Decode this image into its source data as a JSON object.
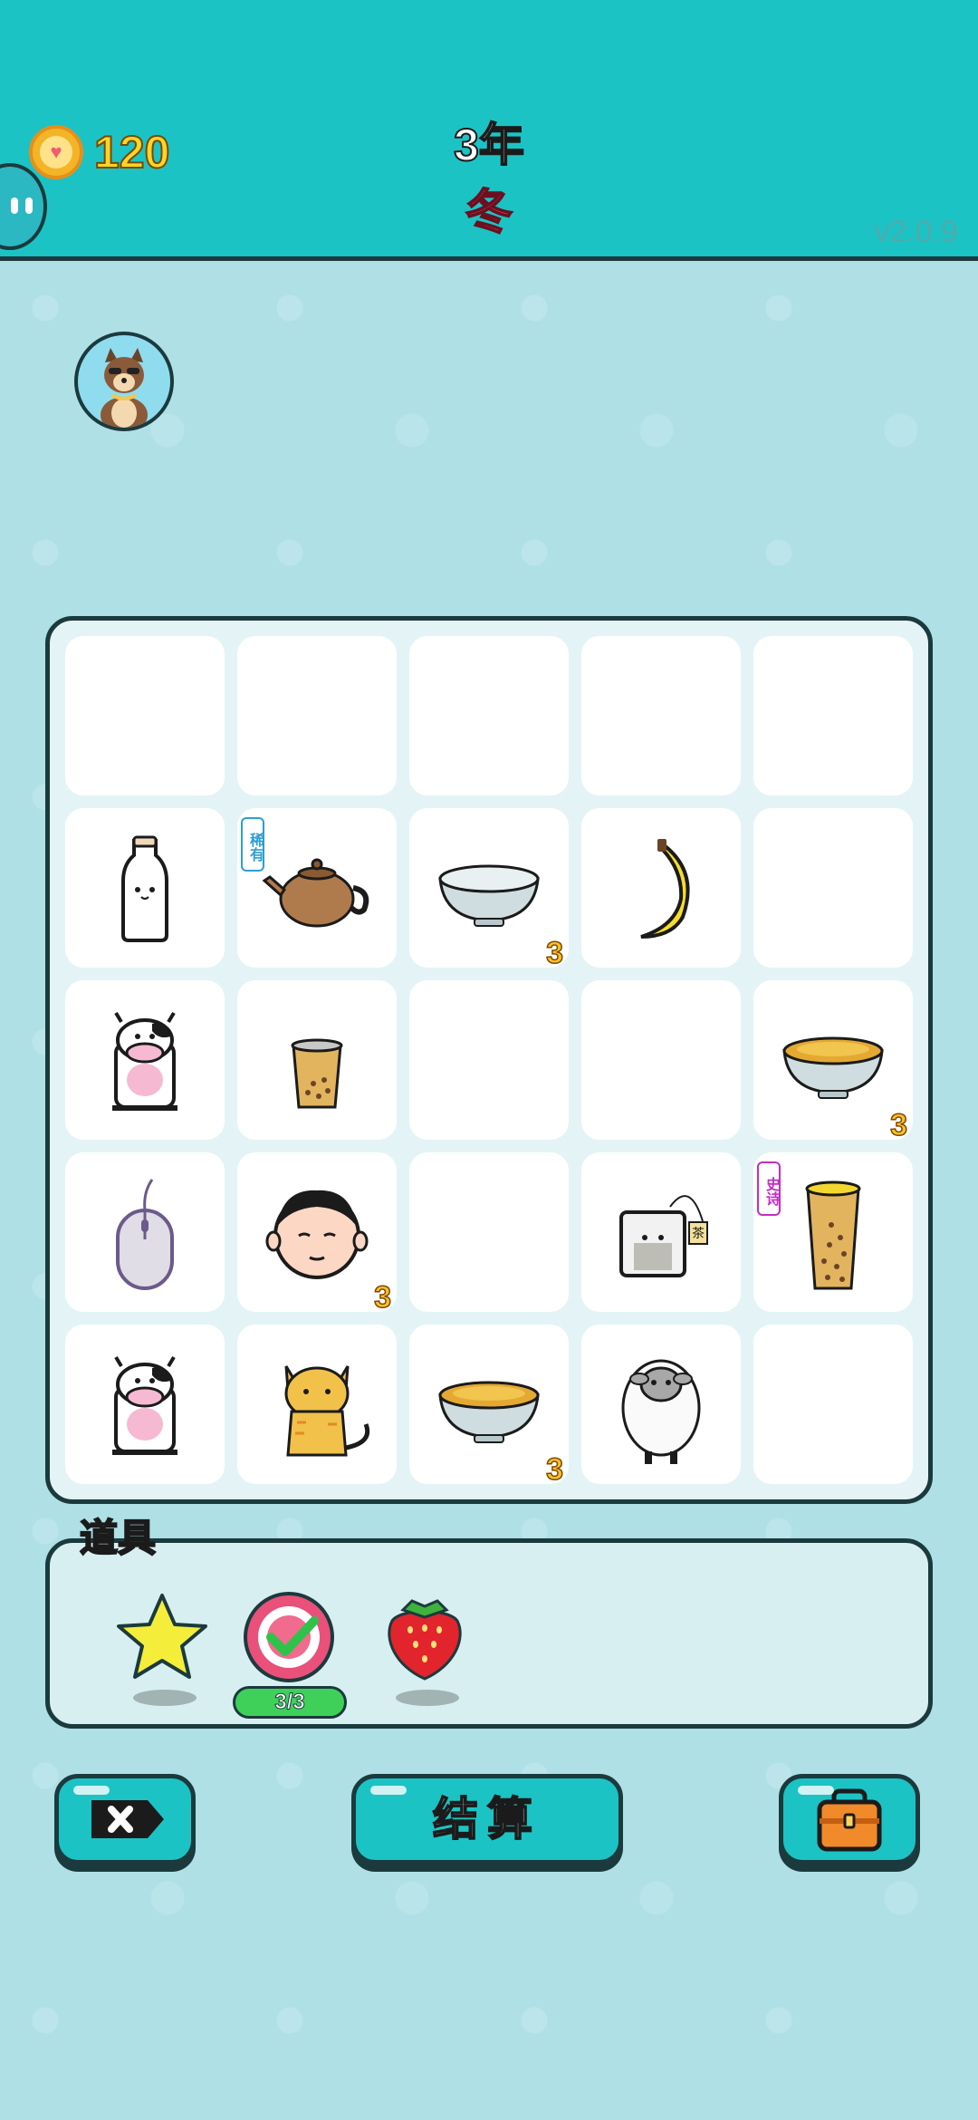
{
  "hud": {
    "coins": "120",
    "year": "3年",
    "season": "冬",
    "version": "v2.0.9"
  },
  "board": {
    "cells": [
      {
        "item": "",
        "count": "",
        "tag": ""
      },
      {
        "item": "",
        "count": "",
        "tag": ""
      },
      {
        "item": "",
        "count": "",
        "tag": ""
      },
      {
        "item": "",
        "count": "",
        "tag": ""
      },
      {
        "item": "",
        "count": "",
        "tag": ""
      },
      {
        "item": "milk-bottle",
        "count": "",
        "tag": ""
      },
      {
        "item": "teapot",
        "count": "",
        "tag": "稀有"
      },
      {
        "item": "empty-bowl",
        "count": "3",
        "tag": ""
      },
      {
        "item": "banana",
        "count": "",
        "tag": ""
      },
      {
        "item": "",
        "count": "",
        "tag": ""
      },
      {
        "item": "cow",
        "count": "",
        "tag": ""
      },
      {
        "item": "small-bubble-tea",
        "count": "",
        "tag": ""
      },
      {
        "item": "",
        "count": "",
        "tag": ""
      },
      {
        "item": "",
        "count": "",
        "tag": ""
      },
      {
        "item": "tea-bowl",
        "count": "3",
        "tag": ""
      },
      {
        "item": "mouse",
        "count": "",
        "tag": ""
      },
      {
        "item": "face",
        "count": "3",
        "tag": ""
      },
      {
        "item": "",
        "count": "",
        "tag": ""
      },
      {
        "item": "tea-bag",
        "count": "",
        "tag": ""
      },
      {
        "item": "tall-bubble-tea",
        "count": "",
        "tag": "史诗"
      },
      {
        "item": "cow",
        "count": "",
        "tag": ""
      },
      {
        "item": "cat",
        "count": "",
        "tag": ""
      },
      {
        "item": "tea-bowl",
        "count": "3",
        "tag": ""
      },
      {
        "item": "sheep",
        "count": "",
        "tag": ""
      },
      {
        "item": "",
        "count": "",
        "tag": ""
      }
    ],
    "tea_bag_label": "茶"
  },
  "tools": {
    "label": "道具",
    "items": [
      "star",
      "check-target",
      "strawberry"
    ],
    "counter": "3/3"
  },
  "buttons": {
    "settle": "结算"
  }
}
